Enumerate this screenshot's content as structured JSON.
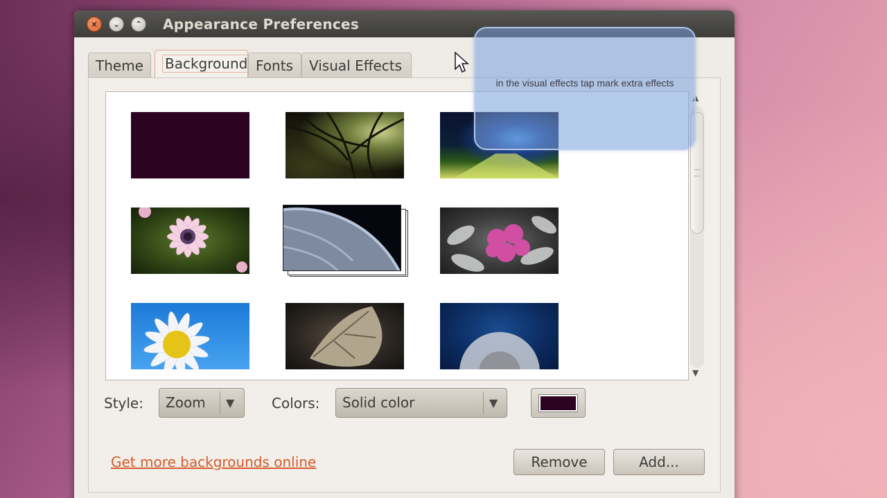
{
  "window": {
    "title": "Appearance Preferences",
    "buttons": {
      "close": "×",
      "minimize": "⌄",
      "maximize": "⌃"
    }
  },
  "tabs": [
    {
      "label": "Theme",
      "active": false
    },
    {
      "label": "Background",
      "active": true
    },
    {
      "label": "Fonts",
      "active": false
    },
    {
      "label": "Visual Effects",
      "active": false
    }
  ],
  "gallery": {
    "wallpapers": [
      {
        "name": "solid-color",
        "selected": false
      },
      {
        "name": "tree-branches",
        "selected": false
      },
      {
        "name": "green-light-road",
        "selected": false
      },
      {
        "name": "pink-daisy",
        "selected": false
      },
      {
        "name": "earth-from-space",
        "selected": true
      },
      {
        "name": "pink-flower-silver-leaves",
        "selected": false
      },
      {
        "name": "white-daisy-blue-sky",
        "selected": false
      },
      {
        "name": "dry-leaf",
        "selected": false
      },
      {
        "name": "dandelion",
        "selected": false
      }
    ]
  },
  "style": {
    "label": "Style:",
    "value": "Zoom"
  },
  "colors": {
    "label": "Colors:",
    "value": "Solid color",
    "swatch": "#2c0320"
  },
  "link": {
    "label": "Get more backgrounds online"
  },
  "buttons": {
    "remove": "Remove",
    "add": "Add..."
  },
  "annotation": {
    "text": "in the visual effects tap mark extra effects"
  },
  "accent": {
    "link": "#d65a2a",
    "active_tab_border": "#e0a891",
    "close_button": "#d95f2b"
  }
}
